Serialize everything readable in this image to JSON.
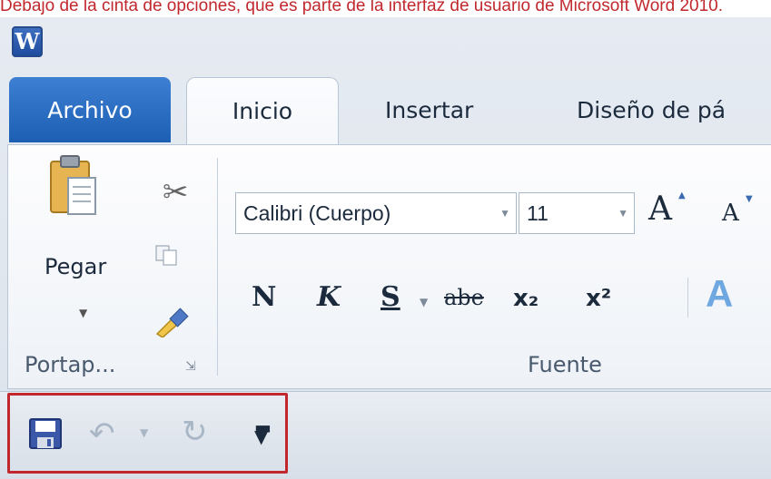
{
  "caption": "Debajo de la cinta de opciones, que es parte de la interfaz de usuario de Microsoft Word 2010.",
  "app_icon": "W",
  "tabs": {
    "archivo": "Archivo",
    "inicio": "Inicio",
    "insertar": "Insertar",
    "diseno": "Diseño de pá"
  },
  "clipboard": {
    "paste_label": "Pegar",
    "group_label": "Portap..."
  },
  "font": {
    "name": "Calibri (Cuerpo)",
    "size": "11",
    "group_label": "Fuente",
    "grow": "A",
    "shrink": "A",
    "bold": "N",
    "italic": "K",
    "underline": "S",
    "strike": "abe",
    "subscript": "x₂",
    "superscript": "x²",
    "effects": "A"
  },
  "colors": {
    "accent_red": "#c0282e",
    "file_tab": "#1c5fb3"
  },
  "quick_access": {
    "icons": [
      "save-icon",
      "undo-icon",
      "redo-icon",
      "customize-icon"
    ]
  }
}
